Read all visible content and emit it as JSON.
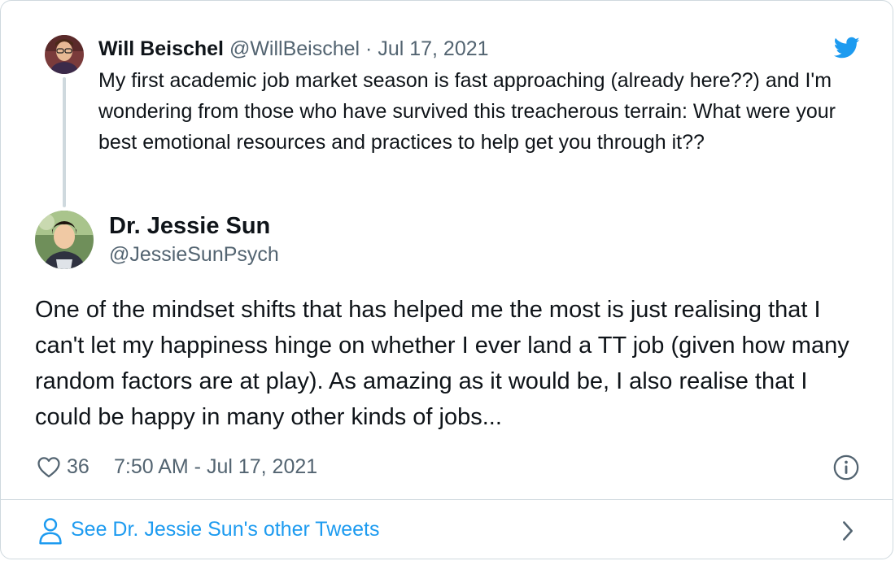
{
  "parent_tweet": {
    "name": "Will Beischel",
    "handle": "@WillBeischel",
    "separator": " · ",
    "date": "Jul 17, 2021",
    "text": "My first academic job market season is fast approaching (already here??) and I'm wondering from those who have survived this treacherous terrain: What were your best emotional resources and practices to help get you through it??",
    "avatar_icon": "avatar-photo-icon"
  },
  "main_tweet": {
    "name": "Dr. Jessie Sun",
    "handle": "@JessieSunPsych",
    "text": "One of the mindset shifts that has helped me the most is just realising that I can't let my happiness hinge on whether I ever land a TT job (given how many random factors are at play). As amazing as it would be, I also realise that I could be happy in many other kinds of jobs...",
    "like_count": "36",
    "timestamp": "7:50 AM - Jul 17, 2021",
    "avatar_icon": "avatar-photo-icon"
  },
  "footer": {
    "see_more_label": "See Dr. Jessie Sun's other Tweets"
  },
  "icons": {
    "brand": "twitter-bird-icon",
    "like": "heart-icon",
    "info": "info-icon",
    "profile": "person-icon",
    "chevron": "chevron-right-icon"
  },
  "colors": {
    "accent": "#1d9bf0",
    "text": "#0f1419",
    "muted": "#536471",
    "border": "#cfd9de"
  }
}
